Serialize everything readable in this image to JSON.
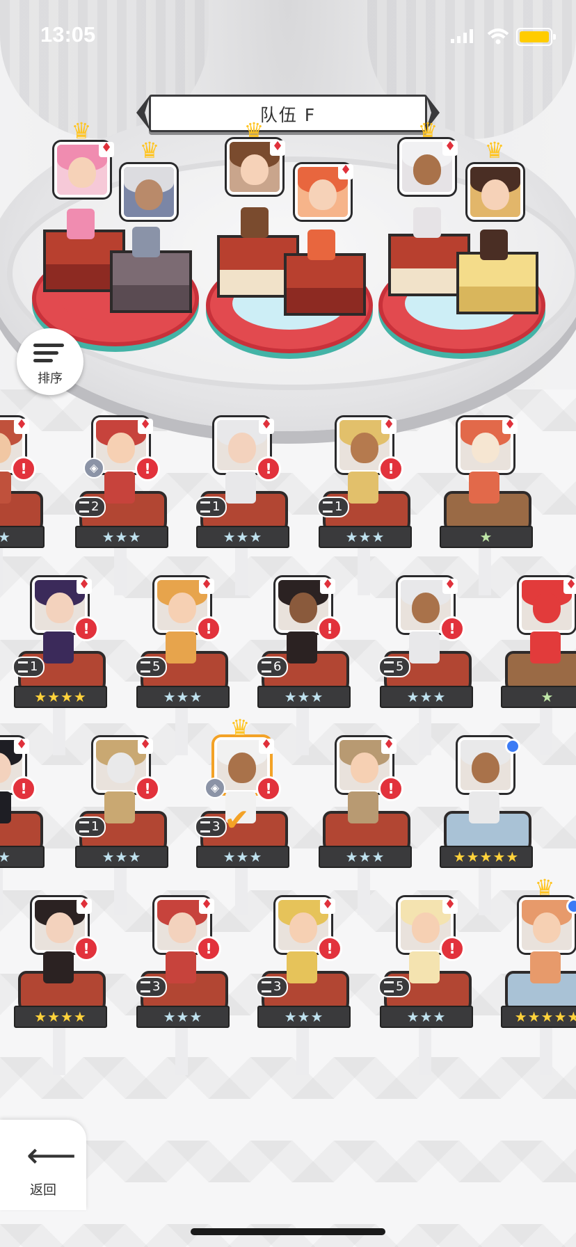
{
  "status_bar": {
    "time": "13:05"
  },
  "team": {
    "title": "队伍 F"
  },
  "sort_button": {
    "label": "排序"
  },
  "back_button": {
    "label": "返回"
  },
  "colors": {
    "alert": "#e2323c",
    "crown": "#ffc524",
    "pedestal_red": "#e24a4f",
    "star_blue": "#bfe1ee",
    "star_gold": "#ffd23b"
  },
  "roster": [
    {
      "stars": "★★",
      "level": "",
      "hair": "#c0513c",
      "skin": "#f1c7a3"
    },
    {
      "stars": "★★★",
      "level": "2",
      "hair": "#c7433c",
      "skin": "#f6d0b3"
    },
    {
      "stars": "★★★",
      "level": "1",
      "hair": "#e8e8ea",
      "skin": "#f3d2bd"
    },
    {
      "stars": "★★★",
      "level": "1",
      "hair": "#e2c06b",
      "skin": "#b57a4e"
    },
    {
      "stars": "★",
      "level": "",
      "hair": "#e2694a",
      "skin": "#f6e6d2"
    },
    {
      "stars": "★★★★",
      "level": "1",
      "hair": "#3b2a5a",
      "skin": "#f3d2bd"
    },
    {
      "stars": "★★★",
      "level": "5",
      "hair": "#e7a44c",
      "skin": "#f6d0b3"
    },
    {
      "stars": "★★★",
      "level": "6",
      "hair": "#2b2222",
      "skin": "#8a5a3c"
    },
    {
      "stars": "★★★",
      "level": "5",
      "hair": "#e8e8ea",
      "skin": "#a9724a"
    },
    {
      "stars": "★",
      "level": "",
      "hair": "#e23b3b",
      "skin": "#e23b3b"
    },
    {
      "stars": "★★",
      "level": "",
      "hair": "#1e1e24",
      "skin": "#f3d2bd"
    },
    {
      "stars": "★★★",
      "level": "1",
      "hair": "#c9a872",
      "skin": "#e9e9ea"
    },
    {
      "stars": "★★★",
      "level": "3",
      "hair": "#f1f1f1",
      "skin": "#a9724a"
    },
    {
      "stars": "★★★",
      "level": "",
      "hair": "#b89a72",
      "skin": "#f6d0b3"
    },
    {
      "stars": "★★★★★",
      "level": "",
      "hair": "#e9e9ea",
      "skin": "#a9724a"
    },
    {
      "stars": "★★★★",
      "level": "",
      "hair": "#2b2222",
      "skin": "#f3d2bd"
    },
    {
      "stars": "★★★",
      "level": "3",
      "hair": "#c7433c",
      "skin": "#f3d2bd"
    },
    {
      "stars": "★★★",
      "level": "3",
      "hair": "#e6c35a",
      "skin": "#f6d0b3"
    },
    {
      "stars": "★★★",
      "level": "5",
      "hair": "#f4e3b0",
      "skin": "#f6d0b3"
    },
    {
      "stars": "★★★★★",
      "level": "",
      "hair": "#e79a6b",
      "skin": "#f6d0b3"
    }
  ]
}
